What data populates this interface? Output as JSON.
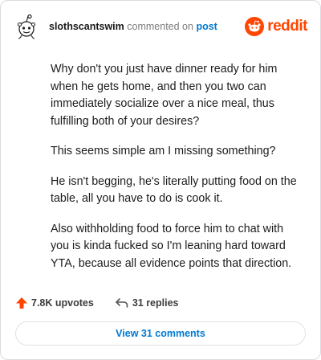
{
  "comment": {
    "username": "slothscantswim",
    "action_text": "commented on",
    "post_link": "post",
    "brand": "reddit",
    "paragraphs": [
      "Why don't you just have dinner ready for him when he gets home, and then you two can immediately socialize over a nice meal, thus fulfilling both of your desires?",
      "This seems simple am I missing something?",
      "He isn't begging, he's literally putting food on the table, all you have to do is cook it.",
      "Also withholding food to force him to chat with you is kinda fucked so I'm leaning hard toward YTA, because all evidence points that direction."
    ],
    "upvotes_label": "7.8K upvotes",
    "replies_label": "31 replies",
    "view_comments_label": "View 31 comments"
  },
  "colors": {
    "brand": "#ff4500",
    "link": "#0079d3",
    "text": "#1c1c1c",
    "muted": "#7c7c7c"
  },
  "icons": [
    "snoo-avatar-icon",
    "reddit-logo-icon",
    "upvote-arrow-icon",
    "reply-arrow-icon"
  ]
}
